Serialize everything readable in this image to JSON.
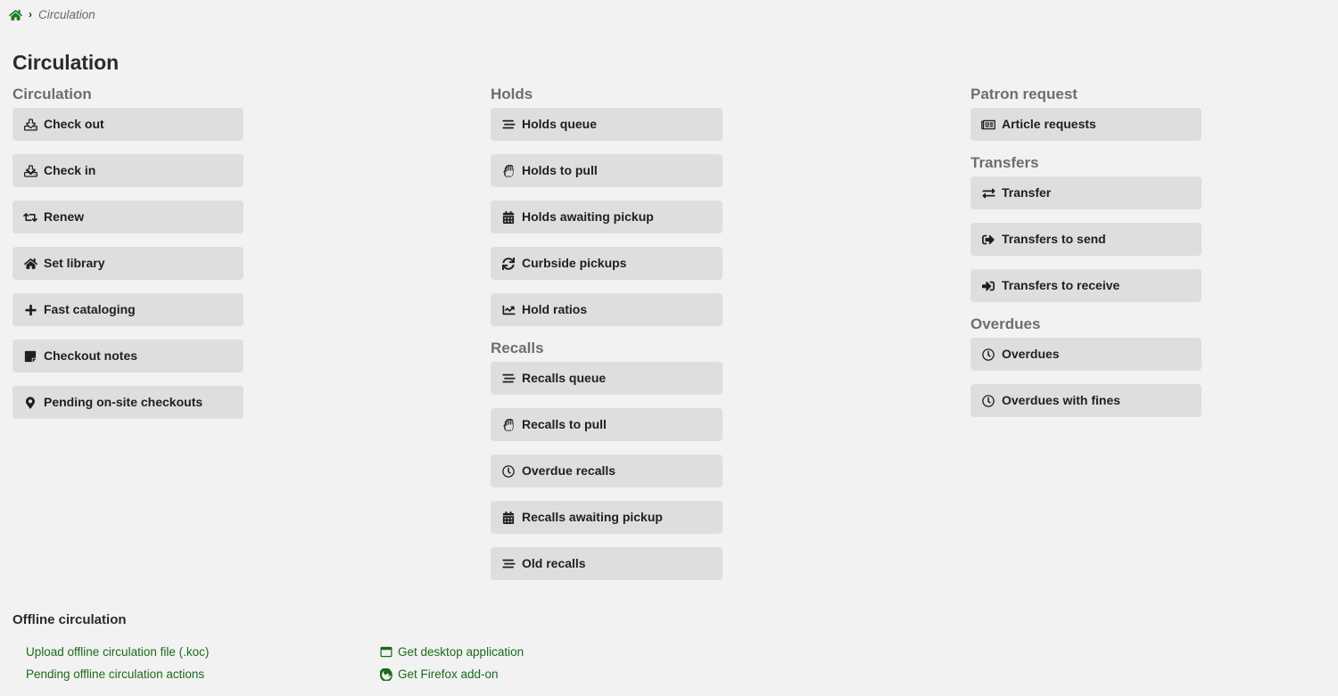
{
  "breadcrumb": {
    "home_icon": "home-icon",
    "separator": "›",
    "current": "Circulation"
  },
  "page_title": "Circulation",
  "colors": {
    "page_background": "#f2f2f2",
    "button_background": "#dededd",
    "button_text": "#1f1f1f",
    "heading_text": "#6e6e6e",
    "title_text": "#2b2b2b",
    "link_green": "#1a6b1a",
    "home_icon_green": "#1f7a1f"
  },
  "columns": [
    {
      "name": "column-left",
      "sections": [
        {
          "heading": "Circulation",
          "items": [
            {
              "label": "Check out",
              "icon": "upload-icon"
            },
            {
              "label": "Check in",
              "icon": "download-icon"
            },
            {
              "label": "Renew",
              "icon": "retweet-icon"
            },
            {
              "label": "Set library",
              "icon": "home-icon"
            },
            {
              "label": "Fast cataloging",
              "icon": "plus-icon"
            },
            {
              "label": "Checkout notes",
              "icon": "sticky-note-icon"
            },
            {
              "label": "Pending on-site checkouts",
              "icon": "map-marker-icon"
            }
          ]
        }
      ]
    },
    {
      "name": "column-middle",
      "sections": [
        {
          "heading": "Holds",
          "items": [
            {
              "label": "Holds queue",
              "icon": "stream-icon"
            },
            {
              "label": "Holds to pull",
              "icon": "hand-rock-icon"
            },
            {
              "label": "Holds awaiting pickup",
              "icon": "calendar-icon"
            },
            {
              "label": "Curbside pickups",
              "icon": "sync-icon"
            },
            {
              "label": "Hold ratios",
              "icon": "chart-line-icon"
            }
          ]
        },
        {
          "heading": "Recalls",
          "items": [
            {
              "label": "Recalls queue",
              "icon": "stream-icon"
            },
            {
              "label": "Recalls to pull",
              "icon": "hand-rock-icon"
            },
            {
              "label": "Overdue recalls",
              "icon": "clock-icon"
            },
            {
              "label": "Recalls awaiting pickup",
              "icon": "calendar-icon"
            },
            {
              "label": "Old recalls",
              "icon": "stream-icon"
            }
          ]
        }
      ]
    },
    {
      "name": "column-right",
      "sections": [
        {
          "heading": "Patron request",
          "items": [
            {
              "label": "Article requests",
              "icon": "newspaper-icon"
            }
          ]
        },
        {
          "heading": "Transfers",
          "items": [
            {
              "label": "Transfer",
              "icon": "exchange-icon"
            },
            {
              "label": "Transfers to send",
              "icon": "sign-out-icon"
            },
            {
              "label": "Transfers to receive",
              "icon": "sign-in-icon"
            }
          ]
        },
        {
          "heading": "Overdues",
          "items": [
            {
              "label": "Overdues",
              "icon": "clock-icon"
            },
            {
              "label": "Overdues with fines",
              "icon": "clock-icon"
            }
          ]
        }
      ]
    }
  ],
  "offline": {
    "heading": "Offline circulation",
    "left_links": [
      {
        "label": "Upload offline circulation file (.koc)",
        "icon": null
      },
      {
        "label": "Pending offline circulation actions",
        "icon": null
      }
    ],
    "right_links": [
      {
        "label": "Get desktop application",
        "icon": "window-icon"
      },
      {
        "label": "Get Firefox add-on",
        "icon": "firefox-icon"
      }
    ]
  }
}
